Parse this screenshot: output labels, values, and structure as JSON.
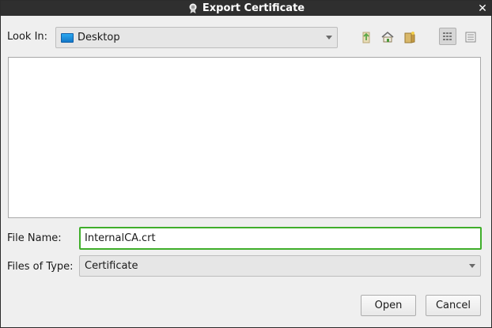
{
  "window": {
    "title": "Export Certificate",
    "title_icon": "certificate-icon",
    "close_icon": "close-icon",
    "close_glyph": "✕"
  },
  "look_in": {
    "label": "Look In:",
    "value": "Desktop",
    "value_icon": "desktop-icon"
  },
  "toolbar": {
    "buttons": [
      {
        "name": "up-one-level",
        "icon": "up-folder-icon"
      },
      {
        "name": "home",
        "icon": "home-icon"
      },
      {
        "name": "new-folder",
        "icon": "new-folder-icon"
      },
      {
        "name": "list-view",
        "icon": "list-view-icon",
        "active": true
      },
      {
        "name": "details-view",
        "icon": "details-view-icon",
        "active": false
      }
    ]
  },
  "file_list": {
    "items": []
  },
  "file_name": {
    "label": "File Name:",
    "value": "InternalCA.crt"
  },
  "file_type": {
    "label": "Files of Type:",
    "value": "Certificate"
  },
  "actions": {
    "open_label": "Open",
    "cancel_label": "Cancel"
  },
  "colors": {
    "titlebar": "#2f2f2f",
    "focus_border": "#3fae2a",
    "dialog_bg": "#efefef"
  }
}
